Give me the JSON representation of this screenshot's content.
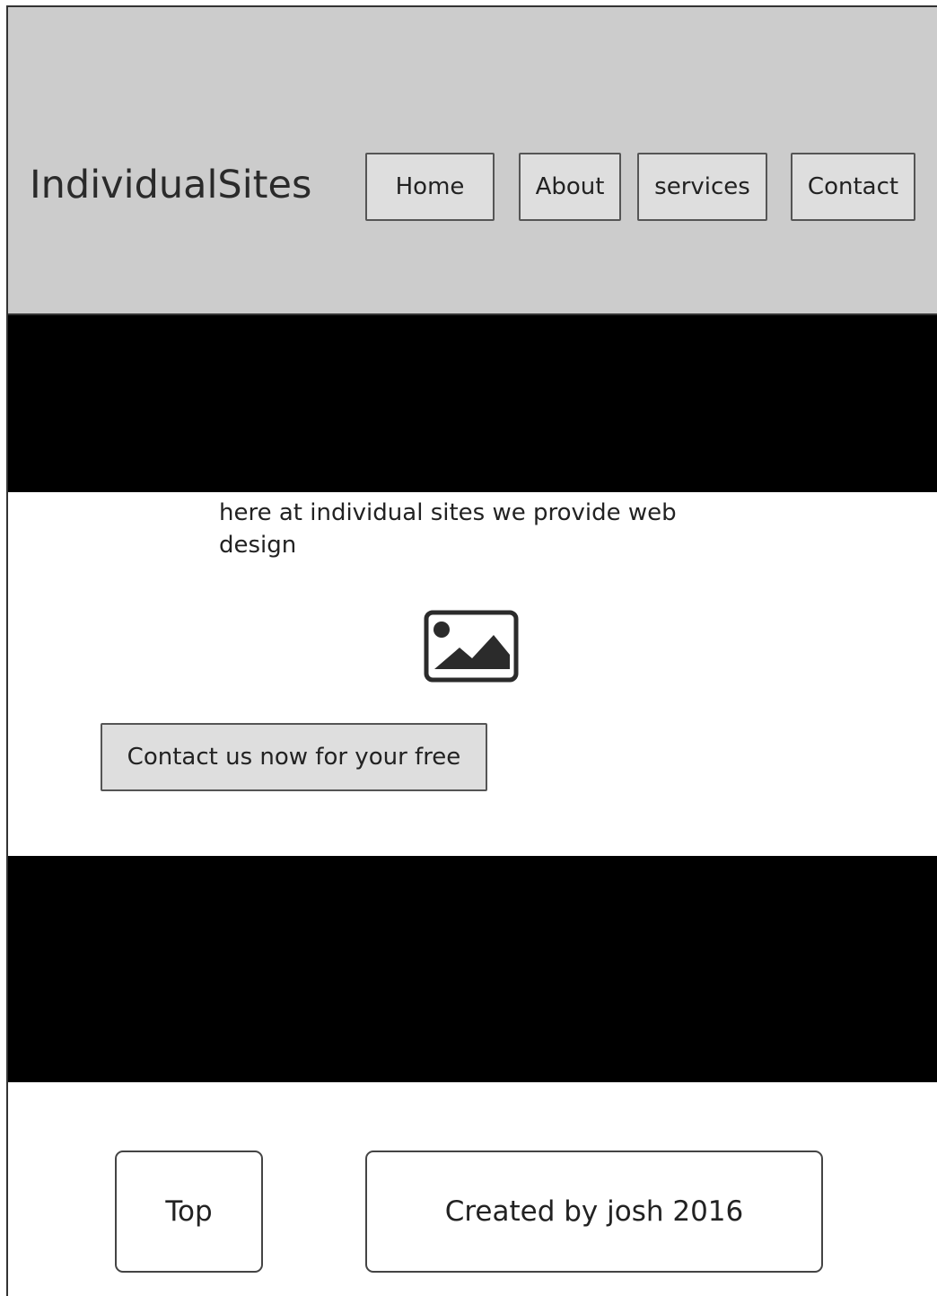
{
  "header": {
    "logo": "IndividualSites",
    "nav": [
      {
        "label": "Home"
      },
      {
        "label": "About"
      },
      {
        "label": "services"
      },
      {
        "label": "Contact"
      }
    ]
  },
  "main": {
    "intro_text": "here at individual sites we provide web design",
    "image_icon": "image-placeholder-icon",
    "cta_label": "Contact us now for your free"
  },
  "footer": {
    "top_label": "Top",
    "credit": "Created by josh 2016"
  },
  "colors": {
    "header_bg": "#cccccc",
    "band": "#000000",
    "button_bg": "#dedede"
  }
}
